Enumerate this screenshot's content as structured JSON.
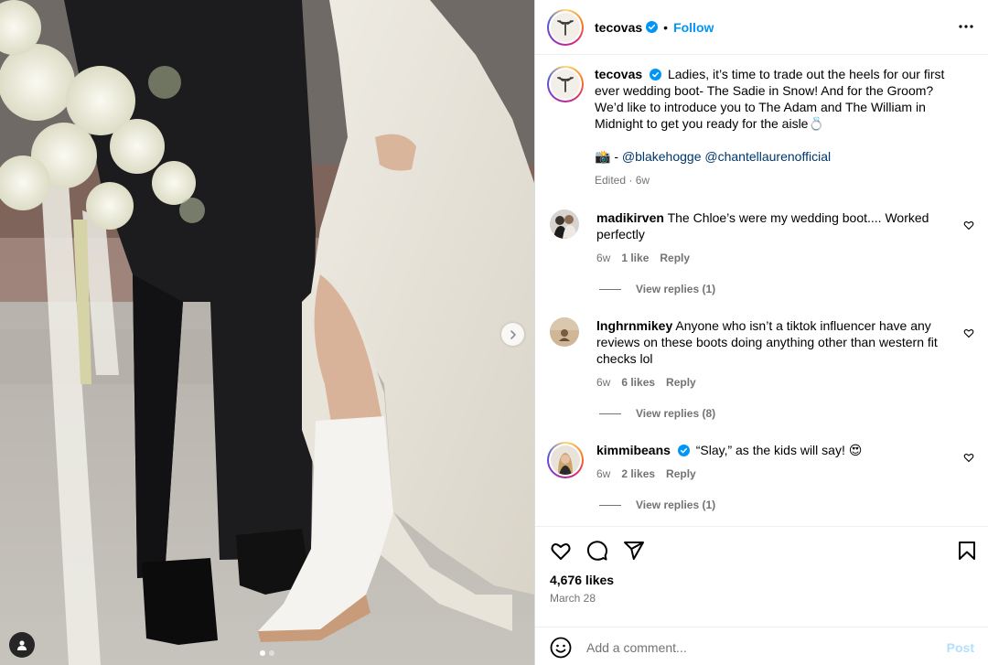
{
  "media": {
    "slide_count": 2,
    "active_slide": 1
  },
  "post": {
    "username": "tecovas",
    "verified": true,
    "separator": "•",
    "follow_label": "Follow"
  },
  "caption": {
    "username": "tecovas",
    "text": "Ladies, it’s time to trade out the heels for our first ever wedding boot- The Sadie in Snow! And for the Groom? We’d like to introduce you to The Adam and The William in Midnight to get you ready for the aisle💍",
    "credit_prefix": "📸 - ",
    "mention_1": "@blakehogge",
    "mention_2": "@chantellaurenofficial",
    "meta": "Edited · 6w"
  },
  "comments": [
    {
      "username": "madikirven",
      "verified": false,
      "text": "The Chloe’s were my wedding boot.... Worked perfectly",
      "time": "6w",
      "likes": "1 like",
      "reply_label": "Reply",
      "view_replies": "View replies (1)"
    },
    {
      "username": "lnghrnmikey",
      "verified": false,
      "text": "Anyone who isn’t a tiktok influencer have any reviews on these boots doing anything other than western fit checks lol",
      "time": "6w",
      "likes": "6 likes",
      "reply_label": "Reply",
      "view_replies": "View replies (8)"
    },
    {
      "username": "kimmibeans",
      "verified": true,
      "text": "“Slay,” as the kids will say! 😍",
      "time": "6w",
      "likes": "2 likes",
      "reply_label": "Reply",
      "view_replies": "View replies (1)"
    }
  ],
  "footer": {
    "likes": "4,676 likes",
    "date": "March 28",
    "comment_placeholder": "Add a comment...",
    "post_label": "Post"
  },
  "icons": {
    "more": "more-horizontal-icon",
    "like": "heart-icon",
    "comment": "comment-bubble-icon",
    "share": "paper-plane-icon",
    "save": "bookmark-icon",
    "emoji": "smiley-icon",
    "next": "chevron-right-icon",
    "tags": "user-tag-icon",
    "verified": "verified-badge-icon"
  },
  "colors": {
    "accent": "#0095f6",
    "verified": "#0095f6",
    "muted_text": "#737373",
    "link": "#00376b",
    "post_disabled": "#b2dffc",
    "border": "#dbdbdb"
  }
}
